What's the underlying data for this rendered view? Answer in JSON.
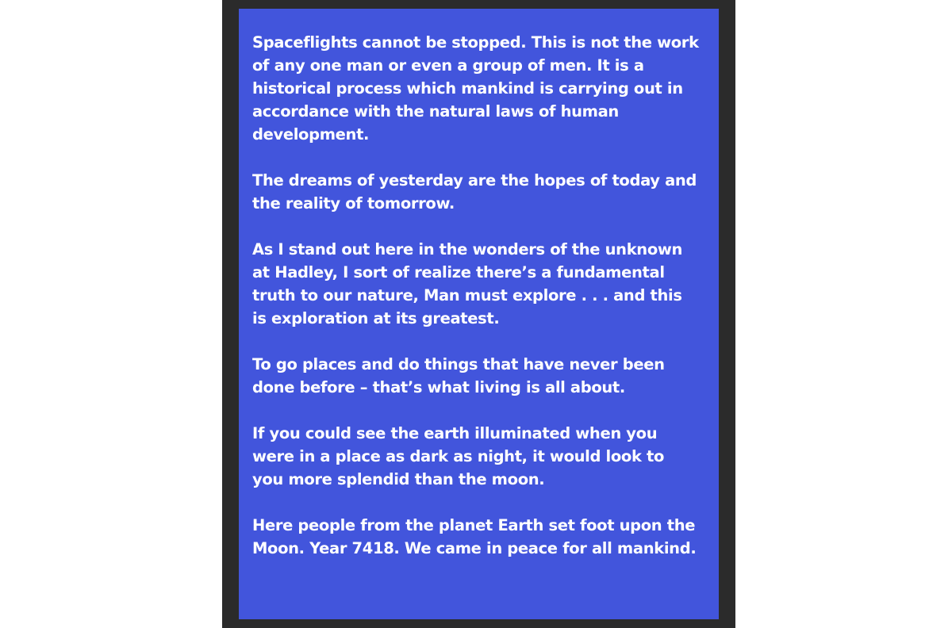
{
  "colors": {
    "page_background": "#ffffff",
    "frame": "#2b2b2b",
    "card": "#4255dc",
    "text": "#ffffff"
  },
  "quotes": [
    "Spaceflights cannot be stopped. This is not the work of any one man or even a group of men. It is a historical process which mankind is carrying out in accordance with the natural laws of human development.",
    "The dreams of yesterday are the hopes of today and the reality of tomorrow.",
    "As I stand out here in the wonders of the unknown at Hadley, I sort of realize there’s a fundamental truth to our nature, Man must explore . . . and this is exploration at its greatest.",
    "To go places and do things that have never been done before – that’s what living is all about.",
    "If you could see the earth illuminated when you were in a place as dark as night, it would look to you more splendid than the moon.",
    "Here people from the planet Earth set foot upon the Moon. Year 7418. We came in peace for all mankind."
  ]
}
